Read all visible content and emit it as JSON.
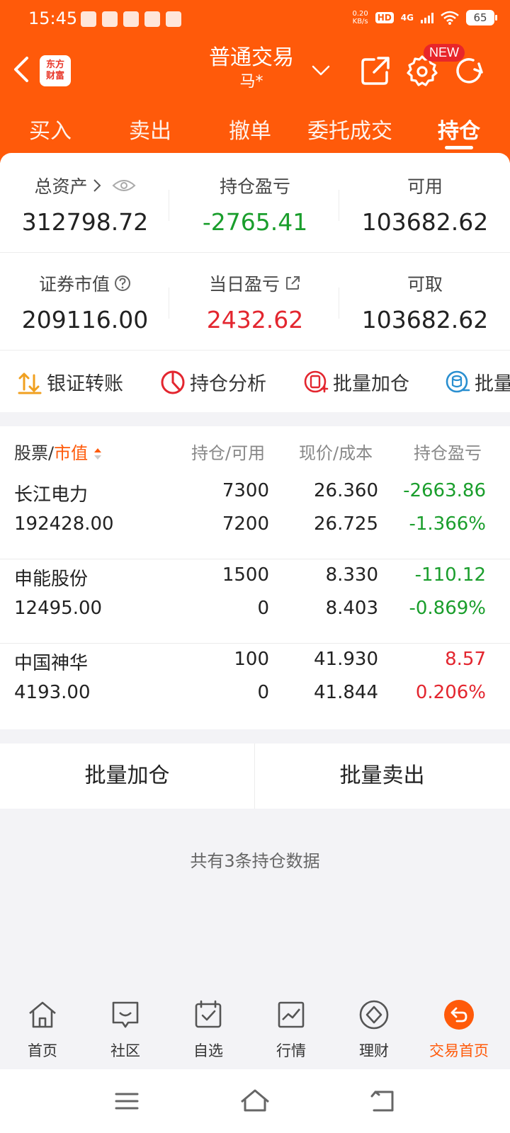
{
  "status_bar": {
    "time": "15:45",
    "net_speed_value": "0.20",
    "net_speed_unit": "KB/s",
    "hd": "HD",
    "signal": "4G",
    "battery": "65"
  },
  "nav": {
    "logo_line1": "东方",
    "logo_line2": "财富",
    "title": "普通交易",
    "subtitle": "马*",
    "new_badge": "NEW"
  },
  "tabs": [
    {
      "label": "买入"
    },
    {
      "label": "卖出"
    },
    {
      "label": "撤单"
    },
    {
      "label": "委托成交"
    },
    {
      "label": "持仓",
      "active": true
    }
  ],
  "summary": {
    "total_assets": {
      "label": "总资产",
      "value": "312798.72"
    },
    "position_pl": {
      "label": "持仓盈亏",
      "value": "-2765.41"
    },
    "available": {
      "label": "可用",
      "value": "103682.62"
    },
    "market_value": {
      "label": "证券市值",
      "value": "209116.00"
    },
    "daily_pl": {
      "label": "当日盈亏",
      "value": "2432.62"
    },
    "withdrawable": {
      "label": "可取",
      "value": "103682.62"
    }
  },
  "quick_actions": [
    {
      "label": "银证转账",
      "icon": "transfer-icon"
    },
    {
      "label": "持仓分析",
      "icon": "pie-chart-icon"
    },
    {
      "label": "批量加仓",
      "icon": "batch-add-icon"
    },
    {
      "label": "批量",
      "icon": "batch-icon"
    }
  ],
  "table": {
    "col_stock": "股票",
    "col_stock_sep": "/",
    "col_mv": "市值",
    "col_sort_icon": "sort-icon",
    "col_qty": "持仓/可用",
    "col_price": "现价/成本",
    "col_pl": "持仓盈亏",
    "rows": [
      {
        "name": "长江电力",
        "market_value": "192428.00",
        "qty": "7300",
        "avail": "7200",
        "price": "26.360",
        "cost": "26.725",
        "pl": "-2663.86",
        "pl_pct": "-1.366%",
        "trend": "down"
      },
      {
        "name": "申能股份",
        "market_value": "12495.00",
        "qty": "1500",
        "avail": "0",
        "price": "8.330",
        "cost": "8.403",
        "pl": "-110.12",
        "pl_pct": "-0.869%",
        "trend": "down"
      },
      {
        "name": "中国神华",
        "market_value": "4193.00",
        "qty": "100",
        "avail": "0",
        "price": "41.930",
        "cost": "41.844",
        "pl": "8.57",
        "pl_pct": "0.206%",
        "trend": "up"
      }
    ]
  },
  "batch": {
    "add": "批量加仓",
    "sell": "批量卖出"
  },
  "count_note": "共有3条持仓数据",
  "bottom_nav": [
    {
      "label": "首页",
      "icon": "home-icon"
    },
    {
      "label": "社区",
      "icon": "community-icon"
    },
    {
      "label": "自选",
      "icon": "watchlist-icon"
    },
    {
      "label": "行情",
      "icon": "market-icon"
    },
    {
      "label": "理财",
      "icon": "wealth-icon"
    },
    {
      "label": "交易首页",
      "icon": "trade-home-icon",
      "active": true
    }
  ],
  "colors": {
    "brand": "#ff5a0a",
    "loss": "#1a9e2c",
    "gain": "#e3262f"
  }
}
